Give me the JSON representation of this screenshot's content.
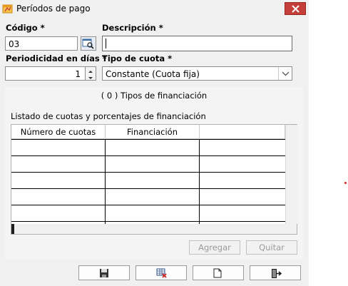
{
  "window": {
    "title": "Períodos de pago"
  },
  "form": {
    "codigo_label": "Código *",
    "codigo_value": "03",
    "descripcion_label": "Descripción *",
    "descripcion_value": "",
    "periodicidad_label": "Periodicidad en días *",
    "periodicidad_value": "1",
    "tipo_cuota_label": "Tipo de cuota *",
    "tipo_cuota_value": "Constante (Cuota fija)"
  },
  "panel": {
    "tipos_text": "( 0 ) Tipos de financiación",
    "list_title": "Listado de cuotas y porcentajes de financiación",
    "columns": [
      "Número de cuotas",
      "Financiación"
    ],
    "row_count": 5,
    "agregar_label": "Agregar",
    "quitar_label": "Quitar"
  },
  "toolbar": {
    "icons": [
      "save-icon",
      "delete-icon",
      "new-document-icon",
      "exit-icon"
    ]
  },
  "colors": {
    "close_button": "#c43e3a",
    "window_bg": "#f0f0f0",
    "disabled_text": "#9a9a9a"
  }
}
